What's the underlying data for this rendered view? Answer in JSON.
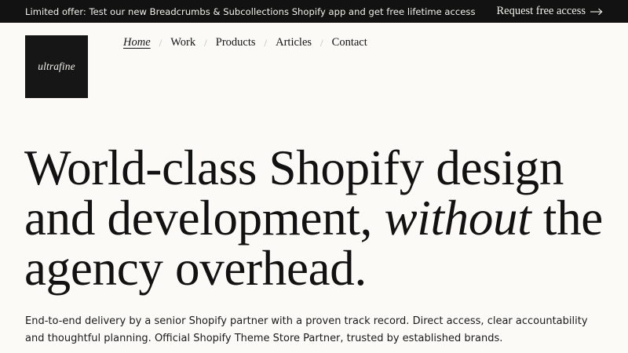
{
  "topbar": {
    "announcement": "Limited offer: Test our new Breadcrumbs & Subcollections Shopify app and get free lifetime access",
    "cta_label": "Request free access",
    "cta_icon": "arrow-right-icon"
  },
  "logo": {
    "text": "ultrafine"
  },
  "nav": {
    "items": [
      {
        "label": "Home",
        "current": true
      },
      {
        "label": "Work"
      },
      {
        "label": "Products"
      },
      {
        "label": "Articles"
      },
      {
        "label": "Contact"
      }
    ],
    "separator": "/"
  },
  "hero": {
    "headline_part1": "World-class Shopify design and development,",
    "headline_emphasis": "without",
    "headline_part2": "the agency overhead.",
    "lede": "End-to-end delivery by a senior Shopify partner with a proven track record. Direct access, clear accountability and thoughtful planning. Official Shopify Theme Store Partner, trusted by established brands."
  },
  "colors": {
    "background": "#fcfaf6",
    "topbar_background": "#121212",
    "text": "#141414",
    "separator": "#b9b6b0"
  }
}
